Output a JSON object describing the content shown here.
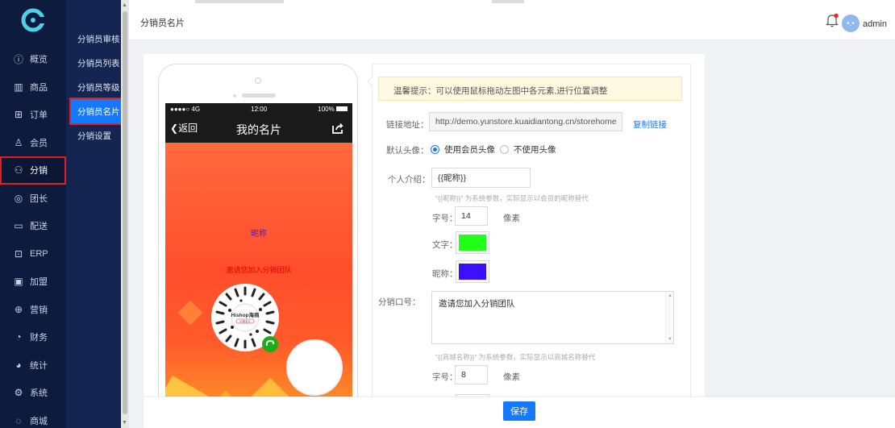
{
  "header": {
    "title": "分销员名片",
    "user": "admin",
    "avatar_text": "•.•"
  },
  "sidebar": {
    "items": [
      {
        "label": "概览",
        "icon": "info-circle-icon"
      },
      {
        "label": "商品",
        "icon": "barcode-icon"
      },
      {
        "label": "订单",
        "icon": "cart-icon"
      },
      {
        "label": "会员",
        "icon": "user-icon"
      },
      {
        "label": "分销",
        "icon": "network-icon",
        "active": true
      },
      {
        "label": "团长",
        "icon": "medal-icon"
      },
      {
        "label": "配送",
        "icon": "truck-icon"
      },
      {
        "label": "ERP",
        "icon": "erp-icon"
      },
      {
        "label": "加盟",
        "icon": "join-icon"
      },
      {
        "label": "营销",
        "icon": "coupon-icon"
      },
      {
        "label": "财务",
        "icon": "finance-icon"
      },
      {
        "label": "统计",
        "icon": "pie-chart-icon"
      },
      {
        "label": "系统",
        "icon": "gear-icon"
      },
      {
        "label": "商城",
        "icon": "chat-icon"
      }
    ]
  },
  "subnav": {
    "items": [
      {
        "label": "分销员审核"
      },
      {
        "label": "分销员列表"
      },
      {
        "label": "分销员等级"
      },
      {
        "label": "分销员名片",
        "active": true
      },
      {
        "label": "分销设置"
      }
    ]
  },
  "phone": {
    "status_signal": "●●●●○ 4G",
    "status_time": "12:00",
    "status_battery": "100%",
    "back_label": "返回",
    "title": "我的名片",
    "nickname": "昵称",
    "slogan": "邀请您加入分销团队",
    "qr_brand": "Hishop海商",
    "qr_sub": "分销名片"
  },
  "form": {
    "tip": "温馨提示：可以使用鼠标拖动左图中各元素,进行位置调整",
    "link_label": "链接地址：",
    "link_value": "http://demo.yunstore.kuaidiantong.cn/storehome",
    "copy_link": "复制链接",
    "avatar_label": "默认头像：",
    "avatar_opt1": "使用会员头像",
    "avatar_opt2": "不使用头像",
    "intro_label": "个人介绍：",
    "intro_value": "{{昵称}}",
    "intro_hint": "\"{{昵称}}\" 为系统参数，实际显示以会员的昵称替代",
    "font_size_label": "字号：",
    "font_size_value": "14",
    "font_unit": "像素",
    "text_color_label": "文字：",
    "text_color": "#22ff1a",
    "nick_color_label": "昵称：",
    "nick_color": "#3a10ff",
    "slogan_label": "分销口号：",
    "slogan_value": "邀请您加入分销团队",
    "slogan_hint": "\"{{商城名称}}\" 为系统参数，实际显示以商城名称替代",
    "font_size2_label": "字号：",
    "font_size2_value": "8",
    "font_unit2": "像素",
    "slogan_color": "#ff3030"
  },
  "footer": {
    "save_label": "保存"
  }
}
